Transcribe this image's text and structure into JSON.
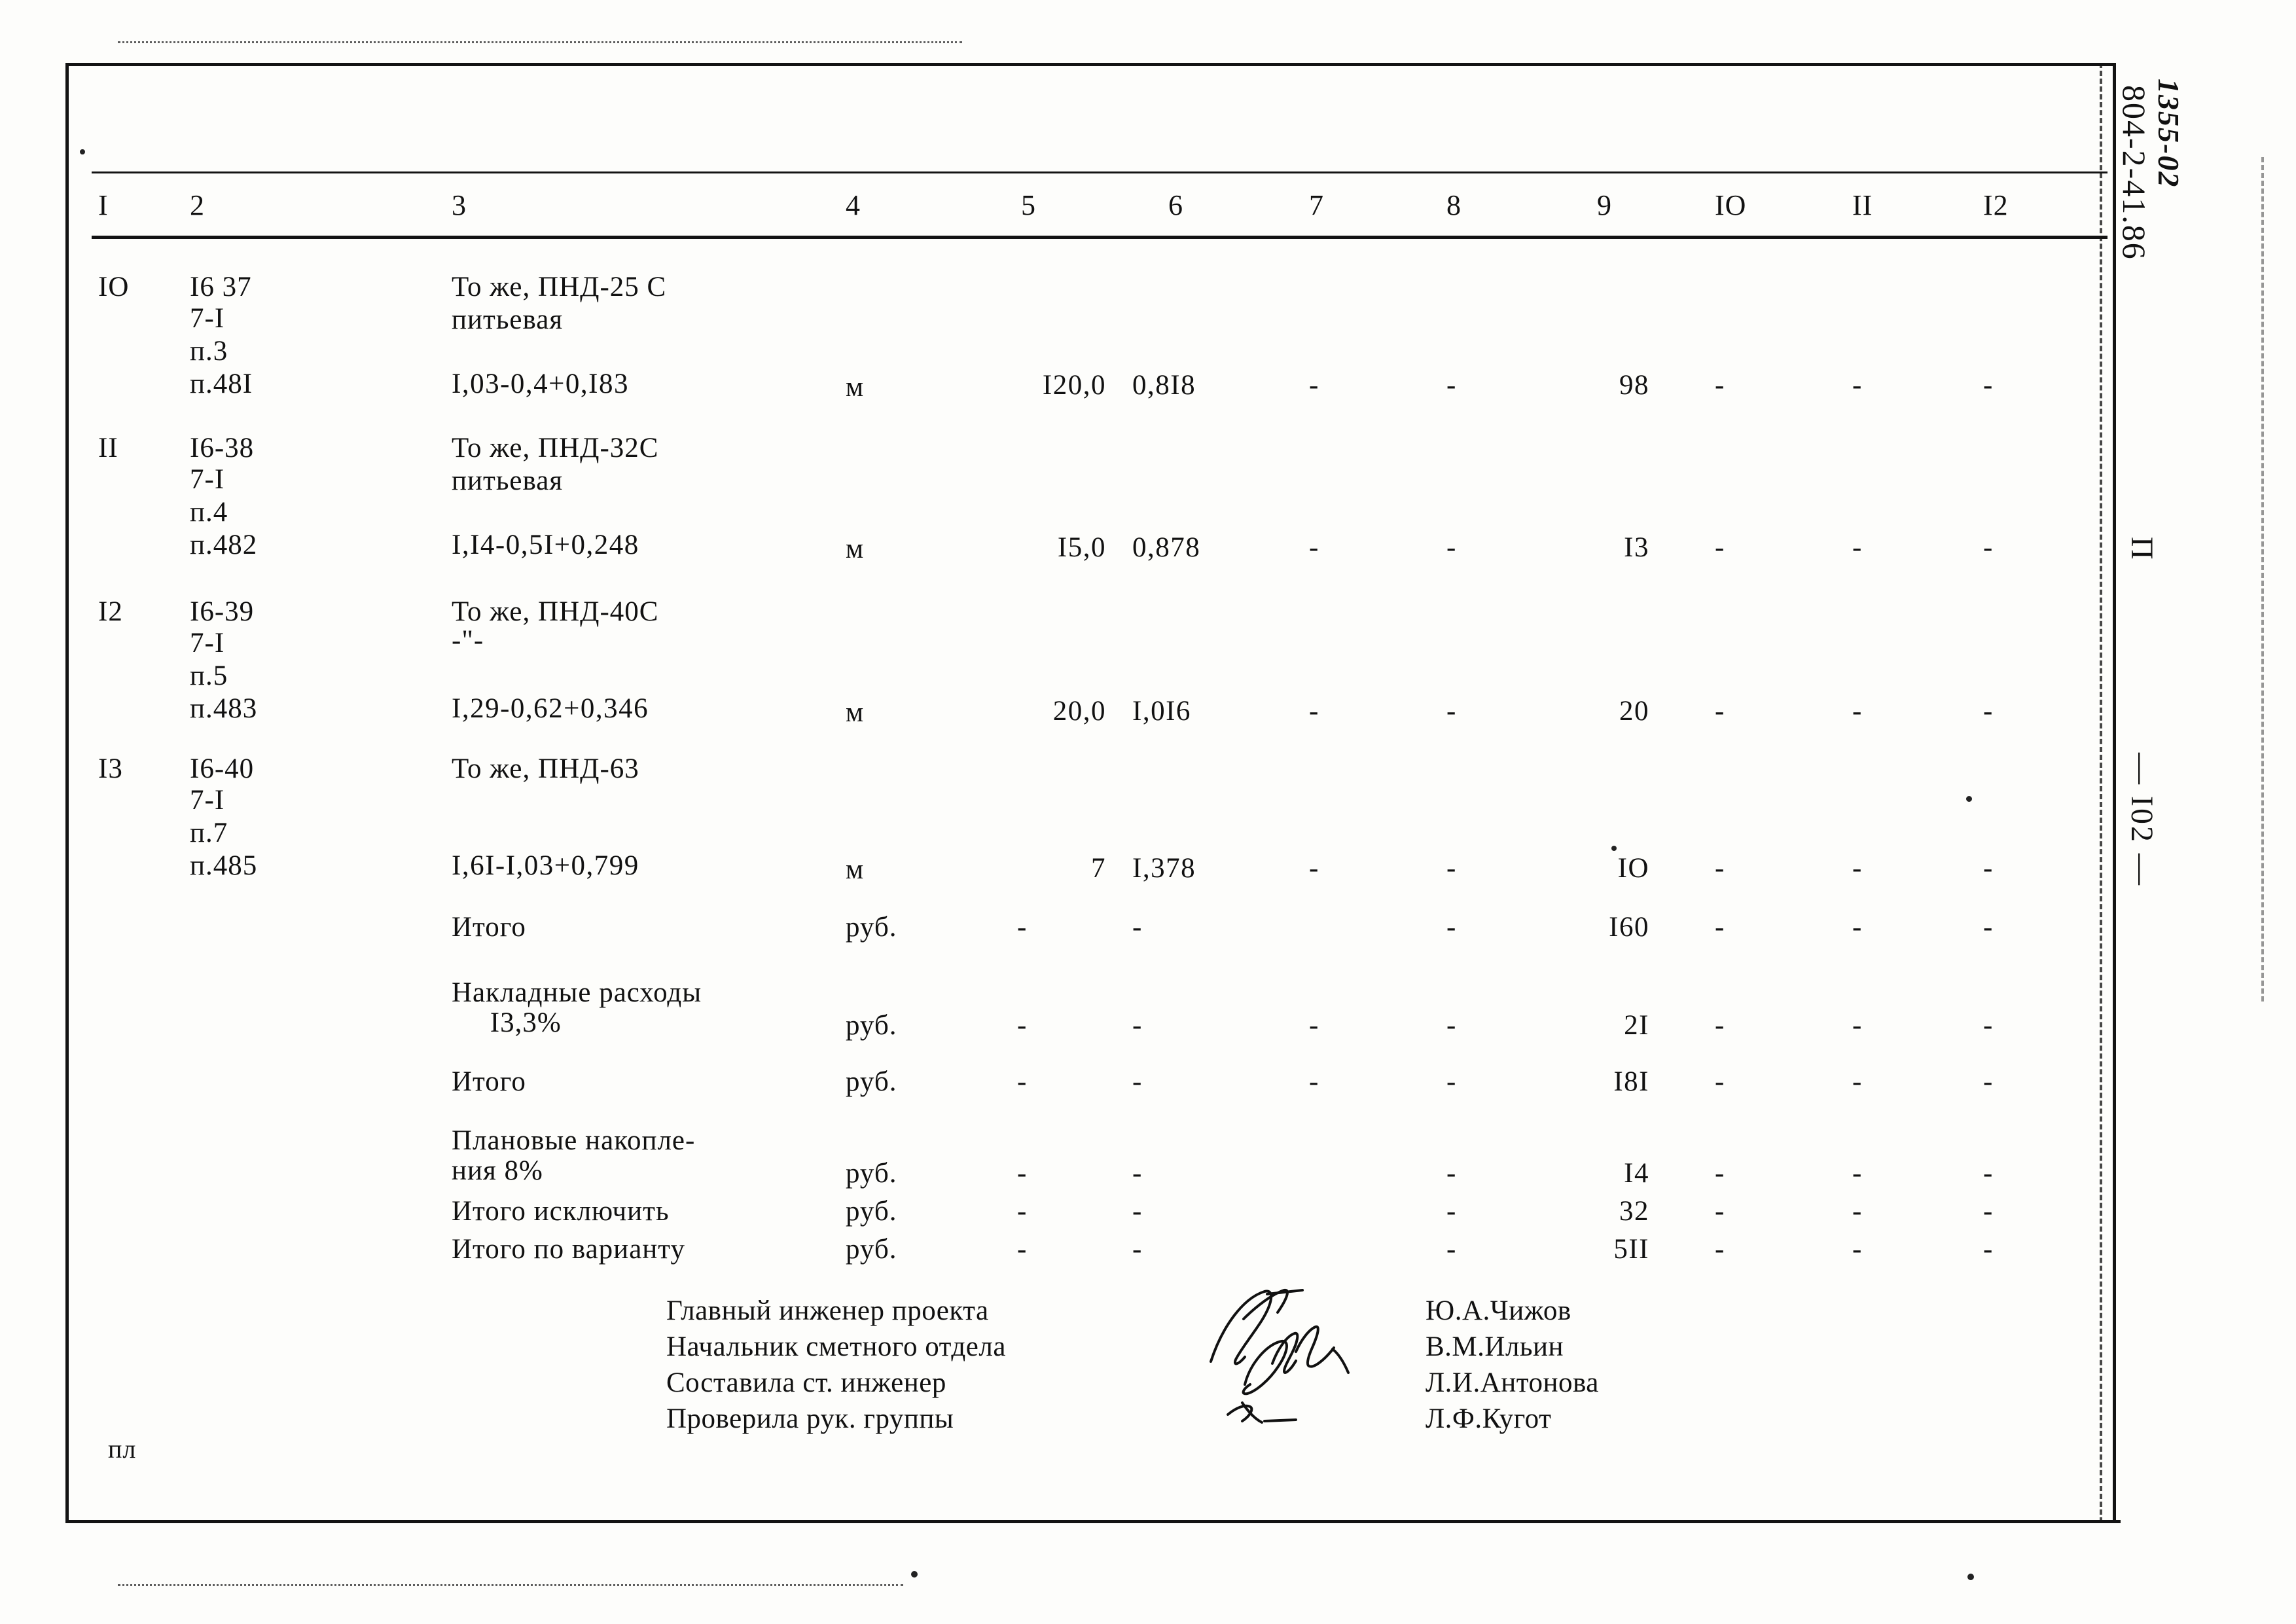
{
  "document": {
    "code_handwritten": "1355-02",
    "code_typed": "804-2-41.86",
    "margin_letter": "П",
    "page_number": "— I02 —",
    "footer_mark": "пл"
  },
  "table": {
    "headers": [
      "I",
      "2",
      "3",
      "4",
      "5",
      "6",
      "7",
      "8",
      "9",
      "IO",
      "II",
      "I2"
    ],
    "rows": [
      {
        "num": "IO",
        "code_lines": [
          "I6 37",
          "7-I",
          "п.3",
          "п.48I"
        ],
        "desc_lines": [
          "То же, ПНД-25 С",
          "питьевая",
          "",
          "I,03-0,4+0,I83"
        ],
        "unit": "м",
        "c5": "I20,0",
        "c6": "0,8I8",
        "c7": "-",
        "c8": "-",
        "c9": "98",
        "c10": "-",
        "c11": "-",
        "c12": "-"
      },
      {
        "num": "II",
        "code_lines": [
          "I6-38",
          "7-I",
          "п.4",
          "п.482"
        ],
        "desc_lines": [
          "То же, ПНД-32С",
          "питьевая",
          "",
          "I,I4-0,5I+0,248"
        ],
        "unit": "м",
        "c5": "I5,0",
        "c6": "0,878",
        "c7": "-",
        "c8": "-",
        "c9": "I3",
        "c10": "-",
        "c11": "-",
        "c12": "-"
      },
      {
        "num": "I2",
        "code_lines": [
          "I6-39",
          "7-I",
          "п.5",
          "п.483"
        ],
        "desc_lines": [
          "То же, ПНД-40С",
          "-\"-",
          "",
          "I,29-0,62+0,346"
        ],
        "unit": "м",
        "c5": "20,0",
        "c6": "I,0I6",
        "c7": "-",
        "c8": "-",
        "c9": "20",
        "c10": "-",
        "c11": "-",
        "c12": "-"
      },
      {
        "num": "I3",
        "code_lines": [
          "I6-40",
          "7-I",
          "п.7",
          "п.485"
        ],
        "desc_lines": [
          "То же, ПНД-63",
          "",
          "",
          "I,6I-I,03+0,799"
        ],
        "unit": "м",
        "c5": "7",
        "c6": "I,378",
        "c7": "-",
        "c8": "-",
        "c9": "IO",
        "c10": "-",
        "c11": "-",
        "c12": "-"
      }
    ],
    "summary": [
      {
        "label_line1": "Итого",
        "label_line2": "",
        "unit": "руб.",
        "c5": "-",
        "c6": "-",
        "c7": "",
        "c8": "-",
        "c9": "I60",
        "c10": "-",
        "c11": "-",
        "c12": "-"
      },
      {
        "label_line1": "Накладные расходы",
        "label_line2": "     I3,3%",
        "unit": "руб.",
        "c5": "-",
        "c6": "-",
        "c7": "-",
        "c8": "-",
        "c9": "2I",
        "c10": "-",
        "c11": "-",
        "c12": "-"
      },
      {
        "label_line1": "Итого",
        "label_line2": "",
        "unit": "руб.",
        "c5": "-",
        "c6": "-",
        "c7": "-",
        "c8": "-",
        "c9": "I8I",
        "c10": "-",
        "c11": "-",
        "c12": "-"
      },
      {
        "label_line1": "Плановые накопле-",
        "label_line2": "ния 8%",
        "unit": "руб.",
        "c5": "-",
        "c6": "-",
        "c7": "",
        "c8": "-",
        "c9": "I4",
        "c10": "-",
        "c11": "-",
        "c12": "-"
      },
      {
        "label_line1": "Итого исключить",
        "label_line2": "",
        "unit": "руб.",
        "c5": "-",
        "c6": "-",
        "c7": "",
        "c8": "-",
        "c9": "32",
        "c10": "-",
        "c11": "-",
        "c12": "-"
      },
      {
        "label_line1": "Итого по варианту",
        "label_line2": "",
        "unit": "руб.",
        "c5": "-",
        "c6": "-",
        "c7": "",
        "c8": "-",
        "c9": "5II",
        "c10": "-",
        "c11": "-",
        "c12": "-"
      }
    ]
  },
  "signatures": [
    {
      "role": "Главный инженер проекта",
      "name": "Ю.А.Чижов"
    },
    {
      "role": "Начальник сметного отдела",
      "name": "В.М.Ильин"
    },
    {
      "role": "Составила ст. инженер",
      "name": "Л.И.Антонова"
    },
    {
      "role": "Проверила рук. группы",
      "name": "Л.Ф.Кугот"
    }
  ]
}
